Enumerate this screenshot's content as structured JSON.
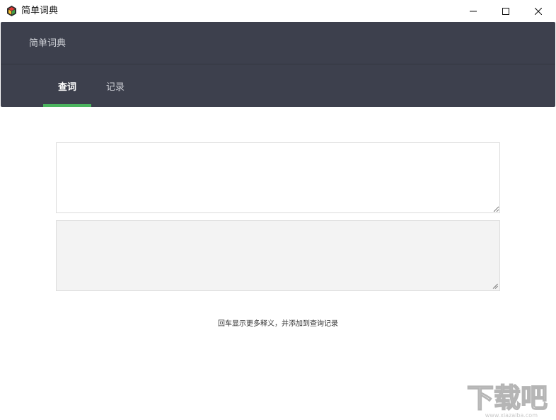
{
  "window": {
    "title": "简单词典",
    "controls": {
      "minimize": "minimize-icon",
      "maximize": "maximize-icon",
      "close": "close-icon"
    }
  },
  "header": {
    "app_name": "简单词典",
    "tabs": [
      {
        "label": "查词",
        "active": true
      },
      {
        "label": "记录",
        "active": false
      }
    ],
    "colors": {
      "background": "#3d404d",
      "active_underline": "#4bb45e"
    }
  },
  "main": {
    "input_placeholder": "",
    "input_value": "",
    "output_value": "",
    "hint": "回车显示更多释义，并添加到查询记录"
  },
  "watermark": {
    "text": "下载吧",
    "url_text": "www.xiazaiba.com"
  }
}
